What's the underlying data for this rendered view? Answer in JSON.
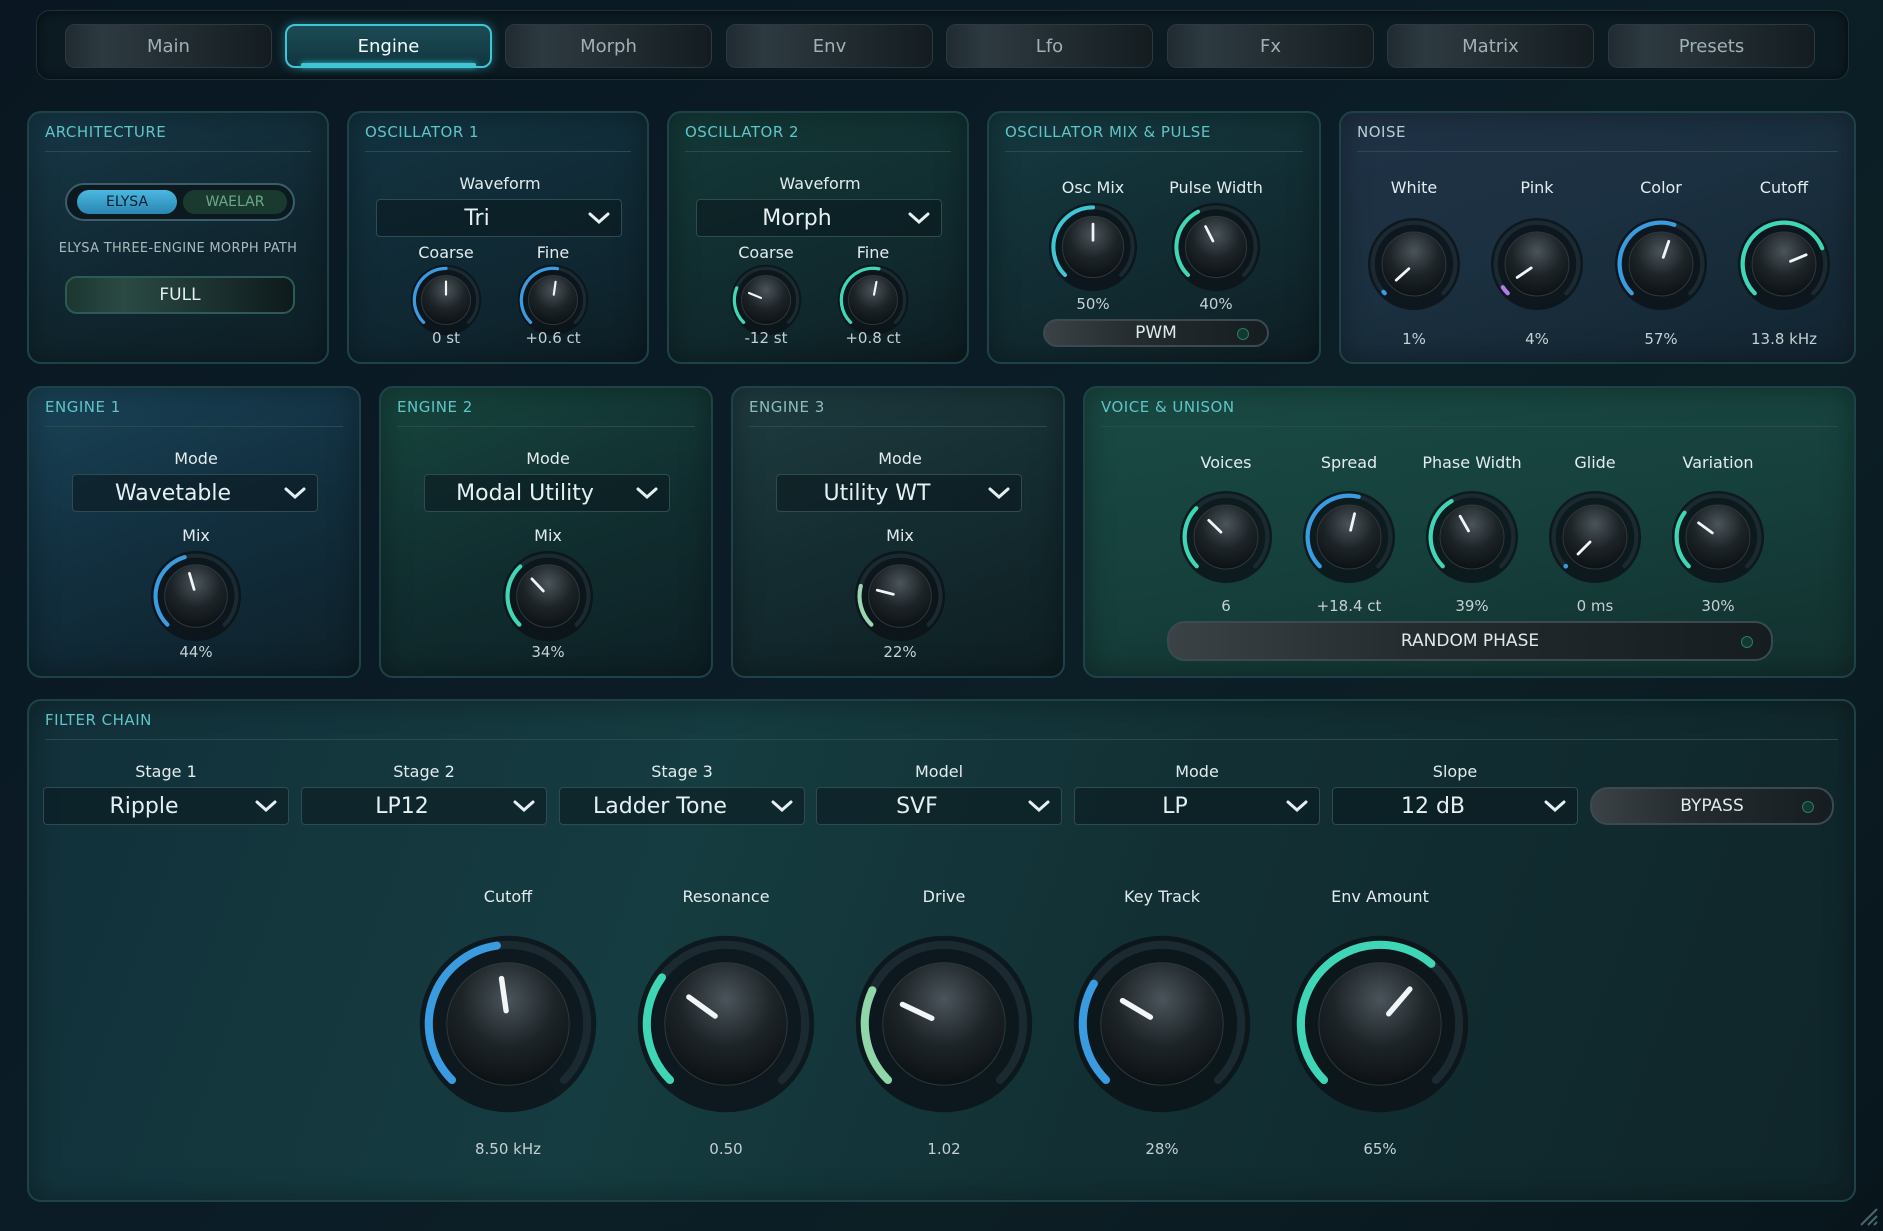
{
  "tabs": [
    {
      "label": "Main"
    },
    {
      "label": "Engine",
      "active": true
    },
    {
      "label": "Morph"
    },
    {
      "label": "Env"
    },
    {
      "label": "Lfo"
    },
    {
      "label": "Fx"
    },
    {
      "label": "Matrix"
    },
    {
      "label": "Presets"
    }
  ],
  "architecture": {
    "title": "ARCHITECTURE",
    "options": [
      "ELYSA",
      "WAELAR"
    ],
    "selected": "ELYSA",
    "description": "ELYSA THREE-ENGINE MORPH PATH",
    "path_button": "FULL"
  },
  "osc1": {
    "title": "OSCILLATOR 1",
    "waveform_label": "Waveform",
    "waveform": "Tri",
    "knobs": [
      {
        "label": "Coarse",
        "value": "0 st",
        "level": 0.5,
        "color": "#3a9be0"
      },
      {
        "label": "Fine",
        "value": "+0.6 ct",
        "level": 0.53,
        "color": "#3a9be0"
      }
    ]
  },
  "osc2": {
    "title": "OSCILLATOR 2",
    "waveform_label": "Waveform",
    "waveform": "Morph",
    "knobs": [
      {
        "label": "Coarse",
        "value": "-12 st",
        "level": 0.25,
        "color": "#3fd6b5"
      },
      {
        "label": "Fine",
        "value": "+0.8 ct",
        "level": 0.54,
        "color": "#3fd6b5"
      }
    ]
  },
  "oscmix": {
    "title": "OSCILLATOR MIX & PULSE",
    "knobs": [
      {
        "label": "Osc Mix",
        "value": "50%",
        "level": 0.5,
        "color": "#3ec6d4"
      },
      {
        "label": "Pulse Width",
        "value": "40%",
        "level": 0.4,
        "color": "#3fd6b5"
      }
    ],
    "pwm_label": "PWM"
  },
  "noise": {
    "title": "NOISE",
    "knobs": [
      {
        "label": "White",
        "value": "1%",
        "level": 0.01,
        "color": "#3a9be0"
      },
      {
        "label": "Pink",
        "value": "4%",
        "level": 0.04,
        "color": "#b07ce8"
      },
      {
        "label": "Color",
        "value": "57%",
        "level": 0.57,
        "color": "#3a9be0"
      },
      {
        "label": "Cutoff",
        "value": "13.8 kHz",
        "level": 0.75,
        "color": "#3fd6b5"
      }
    ]
  },
  "engine1": {
    "title": "ENGINE 1",
    "mode_label": "Mode",
    "mode": "Wavetable",
    "mix_label": "Mix",
    "mix_value": "44%",
    "mix_level": 0.44,
    "color": "#3a9be0"
  },
  "engine2": {
    "title": "ENGINE 2",
    "mode_label": "Mode",
    "mode": "Modal Utility",
    "mix_label": "Mix",
    "mix_value": "34%",
    "mix_level": 0.34,
    "color": "#3fd6b5"
  },
  "engine3": {
    "title": "ENGINE 3",
    "mode_label": "Mode",
    "mode": "Utility WT",
    "mix_label": "Mix",
    "mix_value": "22%",
    "mix_level": 0.22,
    "color": "#9cd6b0"
  },
  "voice": {
    "title": "VOICE & UNISON",
    "knobs": [
      {
        "label": "Voices",
        "value": "6",
        "level": 0.33,
        "color": "#3fd6b5"
      },
      {
        "label": "Spread",
        "value": "+18.4 ct",
        "level": 0.55,
        "color": "#3a9be0"
      },
      {
        "label": "Phase Width",
        "value": "39%",
        "level": 0.39,
        "color": "#3fd6b5"
      },
      {
        "label": "Glide",
        "value": "0 ms",
        "level": 0.0,
        "color": "#3a9be0"
      },
      {
        "label": "Variation",
        "value": "30%",
        "level": 0.3,
        "color": "#3fd6b5"
      }
    ],
    "random_phase_label": "RANDOM PHASE"
  },
  "filter": {
    "title": "FILTER CHAIN",
    "selects": [
      {
        "label": "Stage 1",
        "value": "Ripple"
      },
      {
        "label": "Stage 2",
        "value": "LP12"
      },
      {
        "label": "Stage 3",
        "value": "Ladder Tone"
      },
      {
        "label": "Model",
        "value": "SVF"
      },
      {
        "label": "Mode",
        "value": "LP"
      },
      {
        "label": "Slope",
        "value": "12 dB"
      }
    ],
    "bypass_label": "BYPASS",
    "knobs": [
      {
        "label": "Cutoff",
        "value": "8.50 kHz",
        "level": 0.47,
        "color": "#3a9be0"
      },
      {
        "label": "Resonance",
        "value": "0.50",
        "level": 0.3,
        "color": "#3fd6b5"
      },
      {
        "label": "Drive",
        "value": "1.02",
        "level": 0.26,
        "color": "#8fd6a8"
      },
      {
        "label": "Key Track",
        "value": "28%",
        "level": 0.28,
        "color": "#3a9be0"
      },
      {
        "label": "Env Amount",
        "value": "65%",
        "level": 0.65,
        "color": "#3fd6b5"
      }
    ]
  },
  "colors": {
    "accent": "#3ec6d4",
    "teal": "#3fd6b5",
    "blue": "#3a9be0",
    "violet": "#b07ce8",
    "panel_title": "#5fc5c8"
  }
}
